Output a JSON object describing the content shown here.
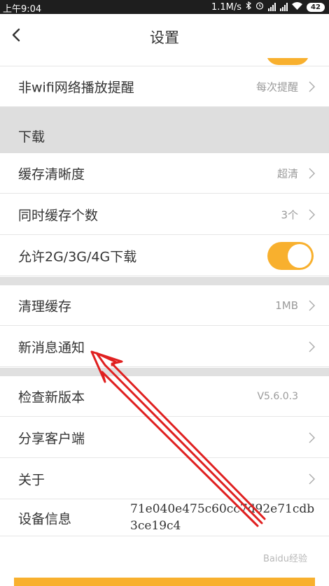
{
  "status_bar": {
    "time": "上午9:04",
    "speed": "1.1M/s",
    "battery": "42"
  },
  "header": {
    "title": "设置"
  },
  "rows": {
    "wifi_reminder": {
      "label": "非wifi网络播放提醒",
      "value": "每次提醒"
    },
    "download_section": "下载",
    "cache_quality": {
      "label": "缓存清晰度",
      "value": "超清"
    },
    "cache_count": {
      "label": "同时缓存个数",
      "value": "3个"
    },
    "allow_mobile_download": {
      "label": "允许2G/3G/4G下载",
      "toggle_on": true
    },
    "clear_cache": {
      "label": "清理缓存",
      "value": "1MB"
    },
    "notifications": {
      "label": "新消息通知"
    },
    "check_update": {
      "label": "检查新版本",
      "value": "V5.6.0.3"
    },
    "share_client": {
      "label": "分享客户端"
    },
    "about": {
      "label": "关于"
    },
    "device_info": {
      "label": "设备信息",
      "value": "71e040e475c60cc7d92e71cdb3ce19c4"
    }
  },
  "watermark": "Baidu经验",
  "colors": {
    "accent": "#f8b02e",
    "section_bg": "#dedede",
    "arrow": "#e02020"
  },
  "icons": {
    "back": "chevron-left-icon",
    "row_arrow": "chevron-right-icon"
  }
}
